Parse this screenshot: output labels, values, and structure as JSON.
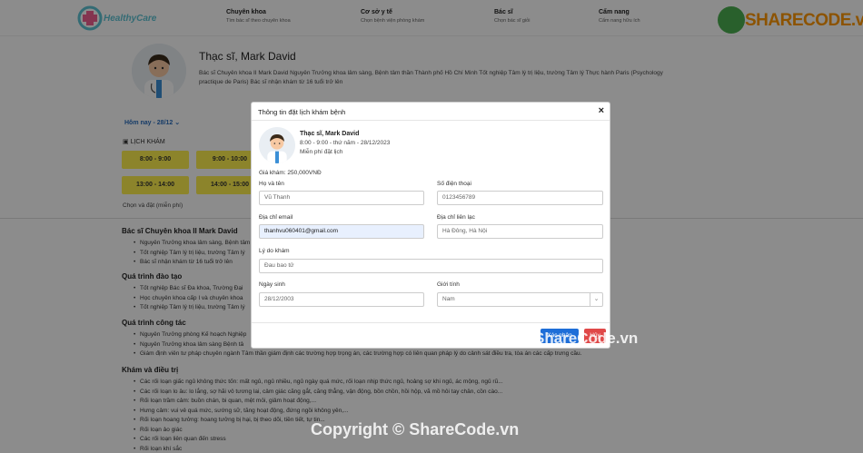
{
  "header": {
    "logo_text": "HealthyCare",
    "nav": [
      {
        "title": "Chuyên khoa",
        "sub": "Tìm bác sĩ theo chuyên khoa"
      },
      {
        "title": "Cơ sở y tế",
        "sub": "Chọn bệnh viện phòng khám"
      },
      {
        "title": "Bác sĩ",
        "sub": "Chọn bác sĩ giỏi"
      },
      {
        "title": "Cẩm nang",
        "sub": "Cẩm nang hữu ích"
      }
    ],
    "sharecode_logo": "SHARECODE.vn"
  },
  "doctor": {
    "name": "Thạc sĩ, Mark David",
    "description": "Bác sĩ Chuyên khoa II Mark David Nguyên Trưởng khoa lâm sàng, Bệnh tâm thần Thành phố Hồ Chí Minh Tốt nghiệp Tâm lý trị liệu, trường Tâm lý Thực hành Paris (Psychology practique de Paris) Bác sĩ nhận khám từ 16 tuổi trở lên"
  },
  "schedule": {
    "date_label": "Hôm nay - 28/12",
    "title": "LỊCH KHÁM",
    "slots": [
      "8:00 - 9:00",
      "9:00 - 10:00",
      "13:00 - 14:00",
      "14:00 - 15:00"
    ],
    "choose_text": "Chọn và đặt (miễn phí)"
  },
  "sections": [
    {
      "title": "Bác sĩ Chuyên khoa II Mark David",
      "items": [
        "Nguyên Trưởng khoa lâm sàng, Bệnh tâm",
        "Tốt nghiệp Tâm lý trị liệu, trường Tâm lý",
        "Bác sĩ nhận khám từ 16 tuổi trở lên"
      ]
    },
    {
      "title": "Quá trình đào tạo",
      "items": [
        "Tốt nghiệp Bác sĩ Đa khoa, Trường Đại",
        "Học chuyên khoa cấp I và chuyên khoa",
        "Tốt nghiệp Tâm lý trị liệu, trường Tâm lý"
      ]
    },
    {
      "title": "Quá trình công tác",
      "items": [
        "Nguyên Trưởng phòng Kế hoạch Nghiệp",
        "Nguyên Trưởng khoa lâm sàng Bệnh tâ",
        "Giám định viên tư pháp chuyên ngành Tâm thần giám định các trường hợp trọng án, các trường hợp có liên quan pháp lý do cảnh sát điều tra, tòa án các cấp trưng cầu."
      ]
    },
    {
      "title": "Khám và điều trị",
      "items": [
        "Các rối loạn giấc ngủ không thức tốn: mất ngủ, ngủ nhiều, ngủ ngày quá mức, rối loạn nhịp thức ngủ, hoảng sợ khi ngủ, ác mộng, ngủ rũ...",
        "Các rối loạn lo âu: lo lắng, sợ hãi vô tương lai, cảm giác căng gắt, căng thẳng, vận động, bồn chồn, hồi hộp, vã mồ hôi tay chân, cồn cào...",
        "Rối loạn trầm cảm: buồn chán, bi quan, mệt mỏi, giảm hoạt động,...",
        "Hưng cảm: vui vẻ quá mức, sướng sữ, tăng hoạt động, đứng ngồi không yên,...",
        "Rối loạn hoang tưởng: hoang tưởng bị hại, bị theo dõi, tiền tiết, tự tin...",
        "Rối loạn ảo giác",
        "Các rối loạn liên quan đến stress",
        "Rối loạn khí sắc"
      ]
    }
  ],
  "modal": {
    "title": "Thông tin đặt lịch khám bệnh",
    "close": "×",
    "doctor_name": "Thạc sĩ, Mark David",
    "time": "8:00 - 9:00 - thứ năm - 28/12/2023",
    "free": "Miễn phí đặt lịch",
    "price": "Giá khám: 250,000VNĐ",
    "fields": {
      "fullname": {
        "label": "Họ và tên",
        "value": "Vũ Thanh"
      },
      "phone": {
        "label": "Số điện thoại",
        "value": "0123456789"
      },
      "email": {
        "label": "Địa chỉ email",
        "value": "thanhvu060401@gmail.com"
      },
      "address": {
        "label": "Địa chỉ liên lạc",
        "value": "Hà Đông, Hà Nội"
      },
      "reason": {
        "label": "Lý do khám",
        "value": "Đau bao tử"
      },
      "birthday": {
        "label": "Ngày sinh",
        "value": "28/12/2003"
      },
      "gender": {
        "label": "Giới tính",
        "value": "Nam"
      }
    },
    "confirm": "Xác nhận",
    "cancel": "Hủy"
  },
  "watermarks": {
    "center": "ShareCode.vn",
    "bottom": "Copyright © ShareCode.vn"
  }
}
